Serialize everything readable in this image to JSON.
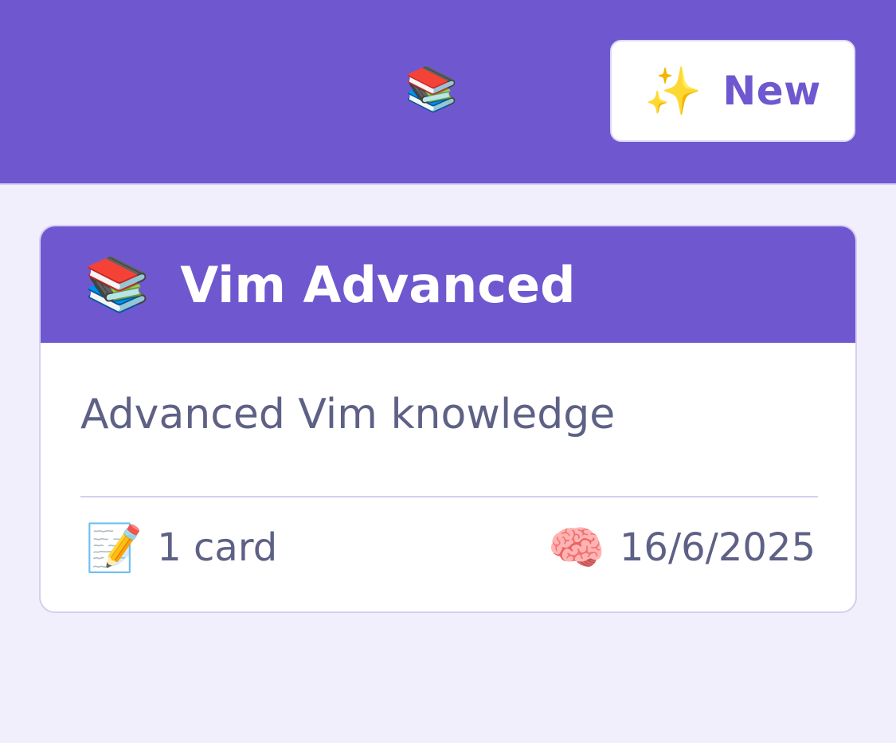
{
  "header": {
    "logo_icon": "books-icon",
    "logo_glyph": "📚",
    "new_button": {
      "icon": "sparkles-icon",
      "icon_glyph": "✨",
      "label": "New"
    }
  },
  "deck": {
    "icon": "books-icon",
    "icon_glyph": "📚",
    "title": "Vim Advanced",
    "description": "Advanced Vim knowledge",
    "card_count": {
      "icon": "memo-icon",
      "icon_glyph": "📝",
      "text": "1 card"
    },
    "last_studied": {
      "icon": "brain-icon",
      "icon_glyph": "🧠",
      "text": "16/6/2025"
    }
  },
  "colors": {
    "primary": "#6f58cf",
    "background": "#f1effc",
    "muted_text": "#5e6185",
    "border": "#d5cff0"
  }
}
